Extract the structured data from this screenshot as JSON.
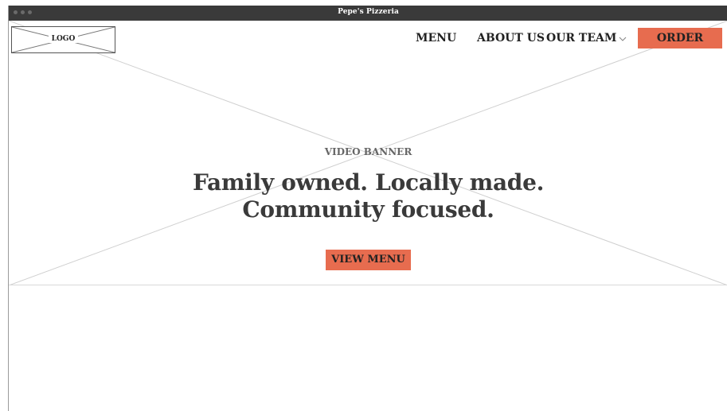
{
  "window": {
    "title": "Pepe's Pizzeria"
  },
  "header": {
    "logo_label": "LOGO",
    "nav": {
      "menu": "MENU",
      "about_us": "ABOUT US",
      "our_team": "OUR TEAM",
      "order": "ORDER"
    }
  },
  "hero": {
    "label": "VIDEO BANNER",
    "headline_line1": "Family owned. Locally made.",
    "headline_line2": "Community focused.",
    "cta": "VIEW MENU"
  },
  "colors": {
    "accent": "#e76c4f",
    "titlebar": "#3a3a3a",
    "text": "#222222"
  },
  "icons": {
    "dropdown": "chevron-down-icon"
  }
}
